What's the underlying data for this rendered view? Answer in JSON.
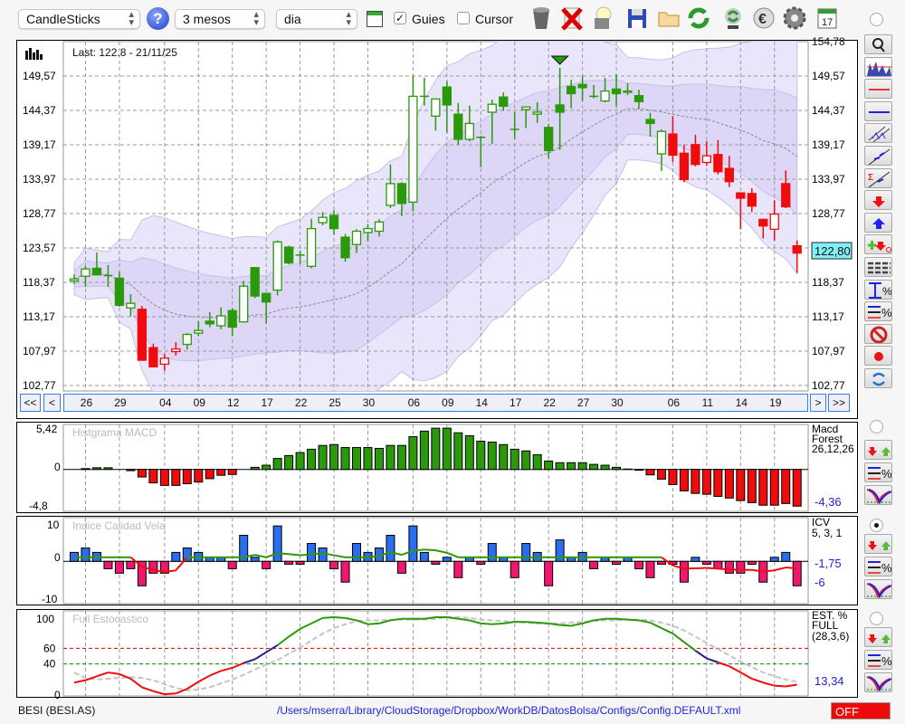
{
  "toolbar": {
    "chart_type": "CandleSticks",
    "period": "3 mesos",
    "interval": "dia",
    "guides_label": "Guies",
    "guides_checked": true,
    "cursor_label": "Cursor",
    "cursor_checked": false,
    "help_label": "?",
    "calendar_day": "17",
    "icons": [
      "trash-icon",
      "delete-icon",
      "lightbulb-icon",
      "save-icon",
      "folder-icon",
      "refresh-icon",
      "sync-icon",
      "euro-icon",
      "gear-icon",
      "calendar-icon"
    ]
  },
  "main_chart": {
    "last_text": "Last: 122.8 - 21/11/25",
    "top_label": "154,78",
    "last_price_label": "122,80",
    "y_ticks": [
      {
        "label": "149,57",
        "v": 149.57
      },
      {
        "label": "144,37",
        "v": 144.37
      },
      {
        "label": "139,17",
        "v": 139.17
      },
      {
        "label": "133,97",
        "v": 133.97
      },
      {
        "label": "128,77",
        "v": 128.77
      },
      {
        "label": "123,57",
        "v": 123.57
      },
      {
        "label": "118,37",
        "v": 118.37
      },
      {
        "label": "113,17",
        "v": 113.17
      },
      {
        "label": "107,97",
        "v": 107.97
      },
      {
        "label": "102,77",
        "v": 102.77
      }
    ],
    "nav": {
      "first": "<<",
      "prev": "<",
      "next": ">",
      "last": ">>"
    },
    "date_ticks": [
      {
        "label": "26",
        "i": 1
      },
      {
        "label": "29",
        "i": 4
      },
      {
        "label": "04",
        "i": 8
      },
      {
        "label": "09",
        "i": 11
      },
      {
        "label": "12",
        "i": 14
      },
      {
        "label": "17",
        "i": 17
      },
      {
        "label": "22",
        "i": 20
      },
      {
        "label": "25",
        "i": 23
      },
      {
        "label": "30",
        "i": 26
      },
      {
        "label": "06",
        "i": 30
      },
      {
        "label": "09",
        "i": 33
      },
      {
        "label": "14",
        "i": 36
      },
      {
        "label": "17",
        "i": 39
      },
      {
        "label": "22",
        "i": 42
      },
      {
        "label": "27",
        "i": 45
      },
      {
        "label": "30",
        "i": 48
      },
      {
        "label": "06",
        "i": 53
      },
      {
        "label": "11",
        "i": 56
      },
      {
        "label": "14",
        "i": 59
      },
      {
        "label": "19",
        "i": 62
      }
    ],
    "signal_marker_index": 43
  },
  "chart_data": [
    {
      "type": "candlestick",
      "title": "BESI (BESI.AS)",
      "ylim": [
        101.9,
        154.78
      ],
      "ohlc": [
        [
          118.6,
          119.6,
          118.1,
          118.9
        ],
        [
          119.3,
          120.8,
          117.7,
          120.4
        ],
        [
          120.5,
          122.9,
          119.5,
          119.5
        ],
        [
          119.4,
          121.0,
          117.7,
          119.4
        ],
        [
          119.0,
          120.0,
          114.7,
          114.9
        ],
        [
          114.5,
          116.6,
          113.2,
          115.2
        ],
        [
          114.3,
          114.8,
          106.5,
          106.6
        ],
        [
          108.5,
          109.1,
          105.5,
          105.6
        ],
        [
          106.0,
          107.5,
          105.0,
          106.9
        ],
        [
          107.9,
          109.3,
          107.3,
          108.3
        ],
        [
          109.0,
          110.7,
          108.2,
          110.5
        ],
        [
          110.7,
          112.5,
          110.3,
          111.1
        ],
        [
          112.5,
          113.9,
          111.6,
          112.1
        ],
        [
          111.8,
          114.6,
          111.3,
          113.3
        ],
        [
          114.1,
          114.5,
          110.3,
          111.6
        ],
        [
          112.4,
          118.6,
          112.3,
          117.8
        ],
        [
          120.6,
          120.7,
          116.0,
          116.3
        ],
        [
          116.7,
          116.7,
          112.1,
          115.4
        ],
        [
          117.2,
          124.7,
          116.4,
          124.5
        ],
        [
          123.7,
          123.9,
          121.1,
          121.3
        ],
        [
          122.5,
          123.2,
          121.2,
          122.5
        ],
        [
          120.8,
          128.0,
          120.5,
          126.5
        ],
        [
          127.4,
          129.0,
          127.0,
          128.2
        ],
        [
          128.5,
          129.3,
          125.6,
          126.5
        ],
        [
          125.2,
          125.7,
          121.5,
          122.1
        ],
        [
          124.1,
          126.4,
          122.8,
          126.1
        ],
        [
          125.9,
          127.2,
          124.6,
          126.5
        ],
        [
          126.1,
          127.9,
          125.3,
          127.5
        ],
        [
          130.0,
          136.2,
          129.6,
          133.3
        ],
        [
          133.3,
          133.5,
          128.4,
          130.3
        ],
        [
          130.5,
          149.6,
          129.1,
          146.5
        ],
        [
          146.5,
          149.3,
          145.1,
          146.5
        ],
        [
          143.5,
          146.1,
          141.3,
          146.1
        ],
        [
          147.9,
          148.8,
          141.0,
          145.2
        ],
        [
          143.8,
          145.5,
          139.2,
          140.0
        ],
        [
          140.0,
          145.1,
          139.7,
          142.4
        ],
        [
          140.3,
          140.5,
          135.8,
          140.3
        ],
        [
          144.1,
          146.0,
          139.3,
          145.3
        ],
        [
          146.4,
          147.1,
          144.3,
          145.0
        ],
        [
          141.5,
          144.1,
          140.1,
          141.5
        ],
        [
          144.5,
          144.9,
          141.7,
          144.9
        ],
        [
          143.8,
          145.6,
          142.5,
          144.1
        ],
        [
          141.8,
          142.3,
          137.1,
          138.3
        ],
        [
          145.2,
          150.8,
          138.4,
          144.1
        ],
        [
          148.0,
          149.0,
          144.7,
          146.9
        ],
        [
          148.3,
          149.6,
          145.8,
          147.8
        ],
        [
          146.5,
          148.2,
          146.2,
          146.5
        ],
        [
          145.8,
          149.3,
          145.6,
          147.3
        ],
        [
          147.6,
          149.8,
          145.0,
          146.9
        ],
        [
          147.1,
          148.5,
          146.7,
          147.3
        ],
        [
          146.6,
          147.5,
          144.6,
          145.7
        ],
        [
          143.0,
          144.0,
          140.4,
          142.4
        ],
        [
          137.8,
          141.5,
          135.2,
          141.2
        ],
        [
          140.8,
          143.5,
          136.6,
          137.6
        ],
        [
          137.9,
          139.2,
          133.5,
          133.9
        ],
        [
          139.2,
          140.7,
          135.9,
          136.2
        ],
        [
          136.5,
          139.7,
          136.0,
          137.5
        ],
        [
          137.7,
          139.9,
          134.7,
          135.1
        ],
        [
          135.6,
          137.5,
          132.8,
          133.6
        ],
        [
          131.9,
          131.9,
          126.4,
          131.1
        ],
        [
          131.8,
          132.6,
          129.0,
          129.9
        ],
        [
          127.9,
          127.9,
          125.0,
          126.9
        ],
        [
          126.4,
          130.8,
          124.7,
          128.7
        ],
        [
          133.3,
          135.3,
          129.6,
          129.8
        ],
        [
          123.9,
          124.7,
          119.8,
          122.8
        ]
      ],
      "trend": [
        1,
        1,
        1,
        1,
        1,
        1,
        -1,
        -1,
        -1,
        -1,
        1,
        1,
        1,
        1,
        1,
        1,
        1,
        1,
        1,
        1,
        1,
        1,
        1,
        1,
        1,
        1,
        1,
        1,
        1,
        1,
        1,
        1,
        1,
        1,
        1,
        1,
        1,
        1,
        1,
        1,
        1,
        1,
        1,
        1,
        1,
        1,
        1,
        1,
        1,
        1,
        1,
        1,
        1,
        -1,
        -1,
        -1,
        -1,
        -1,
        -1,
        -1,
        -1,
        -1,
        -1,
        -1,
        -1
      ],
      "bollinger": {
        "period": 20,
        "outer_sd": 2,
        "inner_sd": 1
      }
    },
    {
      "type": "bar",
      "title": "Histgrama MACD",
      "name_lines": [
        "Macd",
        "Forest",
        "26,12,26"
      ],
      "current_label": "-4,36",
      "y_tick_labels": [
        {
          "label": "5,42",
          "v": 5.42
        },
        {
          "label": "0",
          "v": 0
        },
        {
          "label": "-4,8",
          "v": -4.8
        }
      ],
      "ylim": [
        -5.0,
        5.42
      ],
      "values": [
        0,
        0.1,
        0.2,
        0.2,
        0,
        -0.15,
        -0.9,
        -1.6,
        -1.9,
        -1.9,
        -1.7,
        -1.5,
        -1.1,
        -0.7,
        -0.6,
        0,
        0.25,
        0.5,
        1.3,
        1.65,
        2.0,
        2.4,
        2.85,
        2.95,
        2.6,
        2.6,
        2.6,
        2.5,
        2.85,
        2.85,
        3.9,
        4.55,
        4.9,
        4.9,
        4.35,
        4.0,
        3.35,
        3.25,
        2.95,
        2.4,
        2.2,
        1.75,
        1.0,
        0.8,
        0.8,
        0.8,
        0.6,
        0.5,
        0.25,
        0.05,
        -0.1,
        -0.65,
        -1.15,
        -1.8,
        -2.55,
        -2.85,
        -2.95,
        -3.2,
        -3.4,
        -3.7,
        -3.95,
        -4.25,
        -4.25,
        -4.05,
        -4.36
      ]
    },
    {
      "type": "bar",
      "title": "Indice Calidad Vela",
      "name_lines": [
        "ICV",
        "5, 3, 1"
      ],
      "current_labels": [
        "-1,75",
        "-6"
      ],
      "y_tick_labels": [
        {
          "label": "10",
          "v": 8.7
        },
        {
          "label": "0",
          "v": 0
        },
        {
          "label": "-10",
          "v": -9.4
        }
      ],
      "values": [
        2.2,
        3.3,
        2.2,
        -1.8,
        -2.9,
        -1.8,
        -6.0,
        -2.9,
        -2.9,
        2.2,
        3.3,
        2.2,
        1.0,
        1.0,
        -1.8,
        6.4,
        1.0,
        -1.8,
        8.7,
        -0.7,
        -0.7,
        4.4,
        3.3,
        -1.8,
        -5.1,
        4.4,
        2.2,
        3.3,
        6.4,
        -2.9,
        8.7,
        2.2,
        -0.7,
        1.0,
        -4.0,
        1.0,
        -0.7,
        4.4,
        1.0,
        -4.0,
        4.4,
        2.2,
        -6.0,
        5.3,
        1.0,
        2.2,
        -1.8,
        1.0,
        -0.7,
        1.0,
        -1.8,
        -4.0,
        -0.7,
        -0.7,
        -5.1,
        1.0,
        -0.7,
        -1.8,
        -2.9,
        -2.9,
        -0.7,
        -5.1,
        1.0,
        2.2,
        -6.0
      ],
      "signal": [
        1,
        1,
        1,
        1,
        1,
        1,
        -1.3,
        -2.1,
        -2.6,
        -2.2,
        1,
        1,
        1,
        1,
        1,
        1,
        1.6,
        1,
        2.0,
        1.8,
        1.5,
        1.7,
        2.0,
        1.5,
        1,
        1,
        1,
        1.3,
        2.3,
        1.6,
        2.6,
        2.9,
        2.7,
        2.1,
        1,
        1,
        1,
        1,
        1,
        1,
        1,
        1,
        1,
        1,
        1,
        1,
        1,
        1,
        1,
        1,
        1,
        1,
        1,
        -1.0,
        -1.8,
        -1.7,
        -1.6,
        -1.8,
        -2.0,
        -2.1,
        -2.1,
        -2.5,
        -2.2,
        -1.5,
        -1.75
      ]
    },
    {
      "type": "line",
      "title": "Full Estocastico",
      "name_lines": [
        "EST. %",
        "FULL",
        "(28,3,6)"
      ],
      "current_label": "13,34",
      "y_tick_labels": [
        {
          "label": "100",
          "v": 100
        },
        {
          "label": "60",
          "v": 60
        },
        {
          "label": "40",
          "v": 40
        },
        {
          "label": "0",
          "v": 0
        }
      ],
      "levels": [
        60,
        40
      ],
      "ylim": [
        0,
        100
      ],
      "k": [
        16,
        19,
        24,
        29,
        27,
        21,
        10,
        5,
        1,
        2,
        8,
        17,
        25,
        31,
        35,
        41,
        46,
        55,
        64,
        75,
        85,
        92,
        99,
        100,
        99,
        96,
        91,
        92,
        96,
        98,
        98,
        98,
        100,
        100,
        98,
        96,
        92,
        91,
        92,
        94,
        94,
        93,
        92,
        90,
        89,
        92,
        96,
        98,
        98,
        97,
        96,
        93,
        86,
        79,
        68,
        57,
        47,
        42,
        37,
        29,
        21,
        16,
        12,
        11,
        13.34
      ],
      "d": [
        29,
        22,
        20,
        21,
        22,
        23,
        22,
        19,
        14,
        9,
        6,
        7,
        10,
        15,
        20,
        26,
        33,
        39,
        45,
        53,
        61,
        70,
        79,
        86,
        91,
        95,
        96,
        96,
        97,
        97,
        97,
        97,
        98,
        100,
        100,
        99,
        97,
        96,
        95,
        94,
        93,
        92,
        92,
        92,
        93,
        94,
        95,
        96,
        96,
        97,
        97,
        96,
        93,
        89,
        83,
        75,
        67,
        59,
        51,
        43,
        36,
        29,
        24,
        20,
        17
      ]
    }
  ],
  "side_tools": {
    "main": [
      "zoom-icon",
      "chart-thumbnail-icon",
      "red-line-icon",
      "blue-line-icon",
      "channel-icon",
      "trendline-icon",
      "sigma-trendline-icon",
      "sell-arrow-icon",
      "buy-arrow-icon",
      "add-remove-signal-icon",
      "grid-lines-icon",
      "range-percent-icon",
      "level-percent-icon",
      "no-entry-icon",
      "record-icon",
      "swap-icon"
    ],
    "panels": [
      "signals-icon",
      "level-percent-icon",
      "curves-icon"
    ],
    "selected_panel": 1
  },
  "status": {
    "symbol": "BESI (BESI.AS)",
    "config_path": "/Users/mserra/Library/CloudStorage/Dropbox/WorkDB/DatosBolsa/Configs/Config.DEFAULT.xml",
    "mode": "OFF"
  },
  "colors": {
    "up": "#2a9a0a",
    "down": "#f00c0c",
    "blue": "#2a6ef0",
    "pink": "#f0186e",
    "band_outer": "#e9e5fb",
    "band_inner": "#ddd6f7",
    "stoch_mid": "#2a1a8a"
  }
}
